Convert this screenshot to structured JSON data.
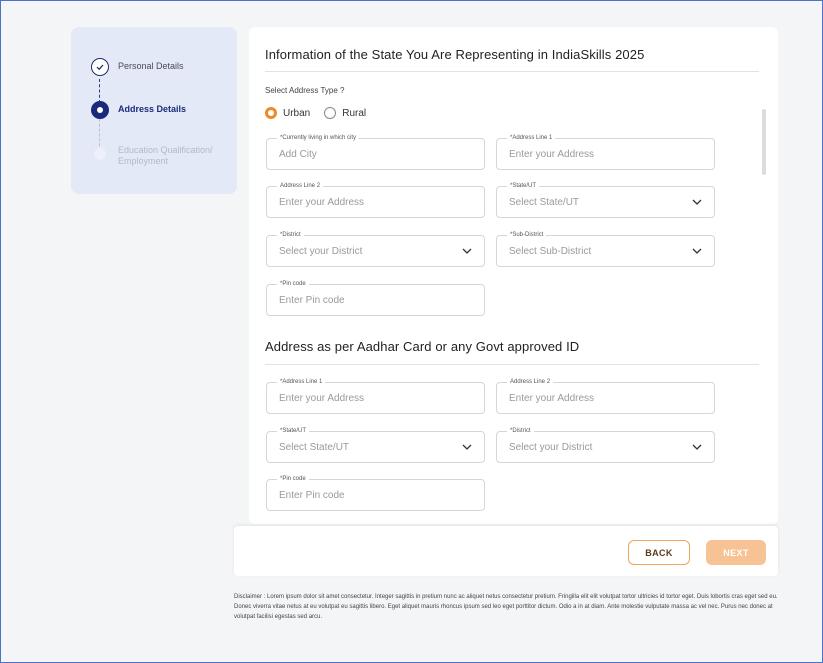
{
  "stepper": {
    "steps": [
      {
        "label": "Personal Details",
        "state": "done"
      },
      {
        "label": "Address Details",
        "state": "active"
      },
      {
        "label": "Education Qualification/",
        "label2": "Employment",
        "state": "pending"
      }
    ]
  },
  "form": {
    "title": "Information of the State You Are Representing in IndiaSkills 2025",
    "address_type_label": "Select Address Type ?",
    "address_type_options": [
      {
        "label": "Urban",
        "selected": true
      },
      {
        "label": "Rural",
        "selected": false
      }
    ],
    "current_address": {
      "city": {
        "label": "*Currently living in which city",
        "placeholder": "Add City"
      },
      "line1": {
        "label": "*Address Line 1",
        "placeholder": "Enter your Address"
      },
      "line2": {
        "label": "Address Line 2",
        "placeholder": "Enter your Address"
      },
      "state": {
        "label": "*State/UT",
        "placeholder": "Select State/UT"
      },
      "district": {
        "label": "*District",
        "placeholder": "Select your District"
      },
      "sub_district": {
        "label": "*Sub-District",
        "placeholder": "Select Sub-District"
      },
      "pincode": {
        "label": "*Pin code",
        "placeholder": "Enter Pin code"
      }
    },
    "aadhar_title": "Address as per Aadhar Card or any Govt approved ID",
    "aadhar_address": {
      "line1": {
        "label": "*Address Line 1",
        "placeholder": "Enter your Address"
      },
      "line2": {
        "label": "Address Line 2",
        "placeholder": "Enter your Address"
      },
      "state": {
        "label": "*State/UT",
        "placeholder": "Select State/UT"
      },
      "district": {
        "label": "*District",
        "placeholder": "Select your District"
      },
      "pincode": {
        "label": "*Pin code",
        "placeholder": "Enter Pin code"
      }
    }
  },
  "footer": {
    "back_label": "BACK",
    "next_label": "NEXT"
  },
  "disclaimer": "Disclaimer : Lorem ipsum dolor sit amet consectetur. Integer sagittis in pretium nunc ac aliquet netus consectetur pretium. Fringilla elit elit volutpat tortor ultricies id tortor eget. Duis lobortis cras eget sed eu. Donec viverra vitae netus at eu volutpat eu sagittis libero. Eget aliquet mauris rhoncus ipsum sed leo eget porttitor dictum. Odio a in at diam. Ante molestie vulputate massa ac vel nec. Purus nec donec at volutpat facilisi egestas sed arcu.",
  "colors": {
    "accent": "#f08a24",
    "primary": "#1a2a7a",
    "stepper_bg": "#e4e9f7"
  }
}
